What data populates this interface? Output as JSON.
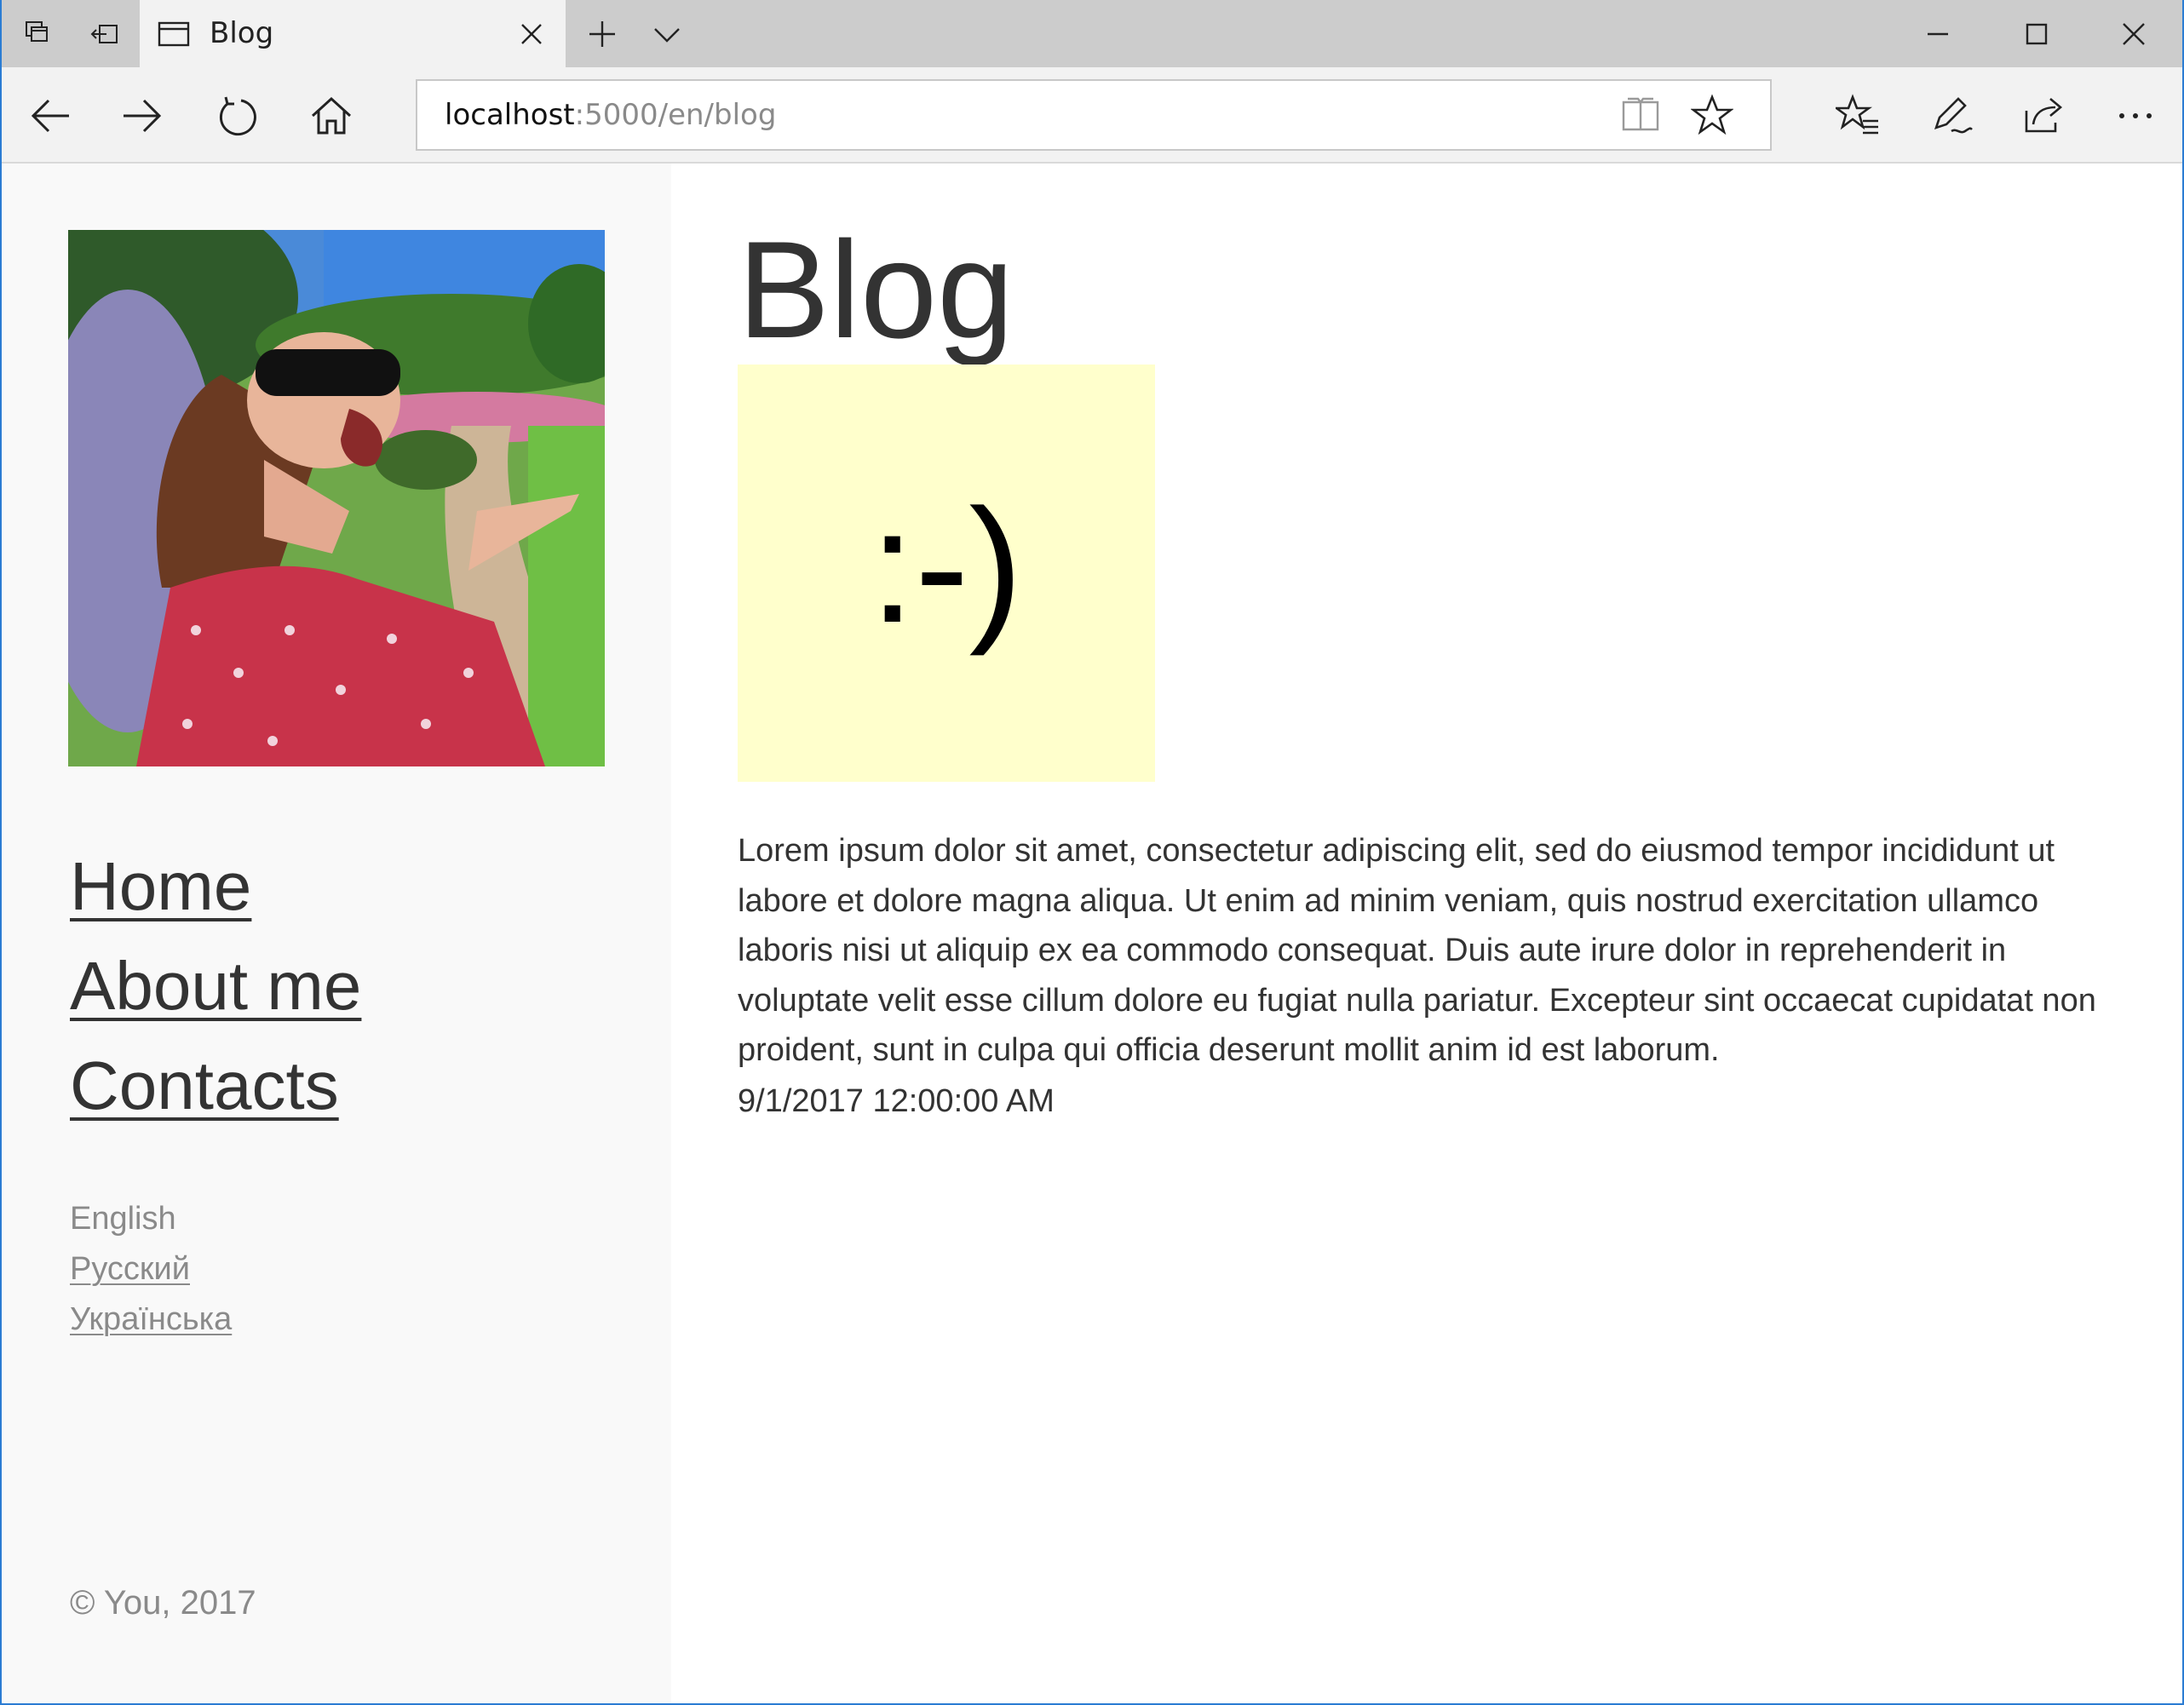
{
  "browser": {
    "tab": {
      "title": "Blog"
    },
    "address": {
      "host": "localhost",
      "rest": ":5000/en/blog"
    },
    "icons": {
      "tab_preview": "tabs-aside-icon",
      "set_aside": "set-aside-icon",
      "new_tab": "plus-icon",
      "tab_menu": "chevron-down-icon",
      "minimize": "minimize-icon",
      "maximize": "maximize-icon",
      "close": "close-icon",
      "back": "back-arrow-icon",
      "forward": "forward-arrow-icon",
      "refresh": "refresh-icon",
      "home": "home-icon",
      "reading_view": "book-icon",
      "favorite": "star-icon",
      "favorites_hub": "favorites-list-icon",
      "notes": "pen-icon",
      "share": "share-icon",
      "more": "more-icon"
    }
  },
  "sidebar": {
    "nav": [
      {
        "label": "Home"
      },
      {
        "label": "About me"
      },
      {
        "label": "Contacts"
      }
    ],
    "languages": [
      {
        "label": "English",
        "current": true
      },
      {
        "label": "Русский",
        "current": false
      },
      {
        "label": "Українська",
        "current": false
      }
    ],
    "copyright": "© You, 2017"
  },
  "main": {
    "title": "Blog",
    "post": {
      "image_text": ":-)",
      "image_bg": "#ffffcc",
      "body": "Lorem ipsum dolor sit amet, consectetur adipiscing elit, sed do eiusmod tempor incididunt ut labore et dolore magna aliqua. Ut enim ad minim veniam, quis nostrud exercitation ullamco laboris nisi ut aliquip ex ea commodo consequat. Duis aute irure dolor in reprehenderit in voluptate velit esse cillum dolore eu fugiat nulla pariatur. Excepteur sint occaecat cupidatat non proident, sunt in culpa qui officia deserunt mollit anim id est laborum.",
      "date": "9/1/2017 12:00:00 AM"
    }
  },
  "colors": {
    "window_border": "#2b7cd3",
    "tabstrip_bg": "#cccccc",
    "sidebar_bg": "#f9f9f9",
    "text": "#333333",
    "muted_text": "#8a8a8a"
  }
}
